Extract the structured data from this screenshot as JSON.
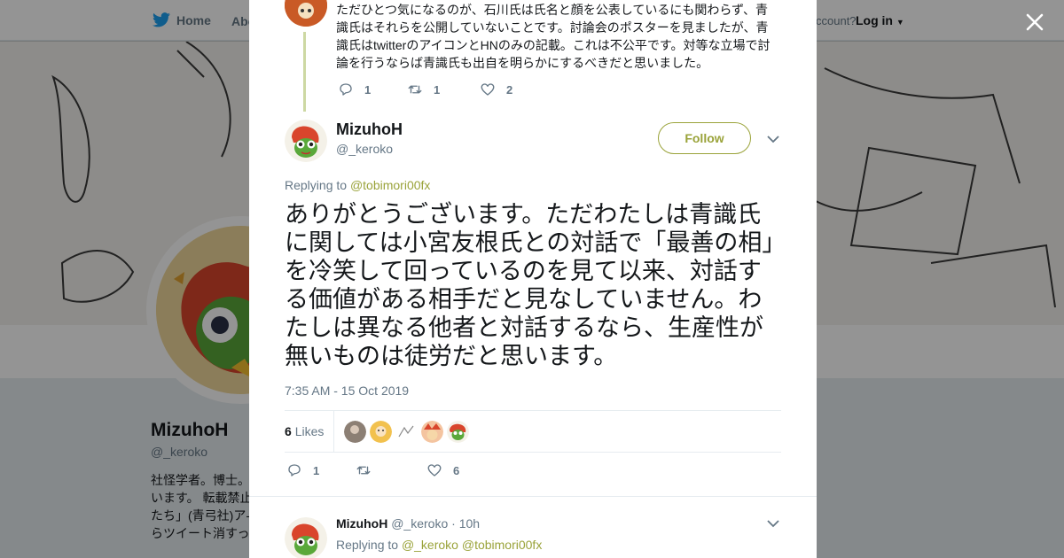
{
  "background": {
    "nav": {
      "home_label": "Home",
      "about_label": "Abo",
      "account_prompt": "ccount?",
      "login_label": "Log in"
    },
    "profile": {
      "name": "MizuhoH",
      "handle": "@_keroko",
      "bio": "社怪学者。博士。\nいます。 転載禁止\nたち」(青弓社)ア-\nらツイート消すっ"
    }
  },
  "modal": {
    "previous_tweet": {
      "text": "ただひとつ気になるのが、石川氏は氏名と顔を公表しているにも関わらず、青識氏はそれらを公開していないことです。討論会のポスターを見ましたが、青識氏はtwitterのアイコンとHNのみの記載。これは不公平です。対等な立場で討論を行うならば青識氏も出自を明らかにするべきだと思いました。",
      "reply_count": "1",
      "retweet_count": "1",
      "like_count": "2"
    },
    "main_tweet": {
      "name": "MizuhoH",
      "handle": "@_keroko",
      "follow_label": "Follow",
      "replying_prefix": "Replying to",
      "replying_to": "@tobimori00fx",
      "text": "ありがとうございます。ただわたしは青識氏に関しては小宮友根氏との対話で「最善の相」を冷笑して回っているのを見て以来、対話する価値がある相手だと見なしていません。わたしは異なる他者と対話するなら、生産性が無いものは徒労だと思います。",
      "timestamp": "7:35 AM - 15 Oct 2019",
      "likes_count": "6",
      "likes_label": "Likes",
      "reply_count": "1",
      "retweet_count": "",
      "like_count": "6"
    },
    "reply_tweet": {
      "name": "MizuhoH",
      "handle": "@_keroko",
      "time": "· 10h",
      "replying_prefix": "Replying to",
      "replying_to_1": "@_keroko",
      "replying_to_2": "@tobimori00fx"
    }
  },
  "colors": {
    "accent": "#9aa33a",
    "twitter_blue": "#1da1f2",
    "text_muted": "#657786"
  }
}
